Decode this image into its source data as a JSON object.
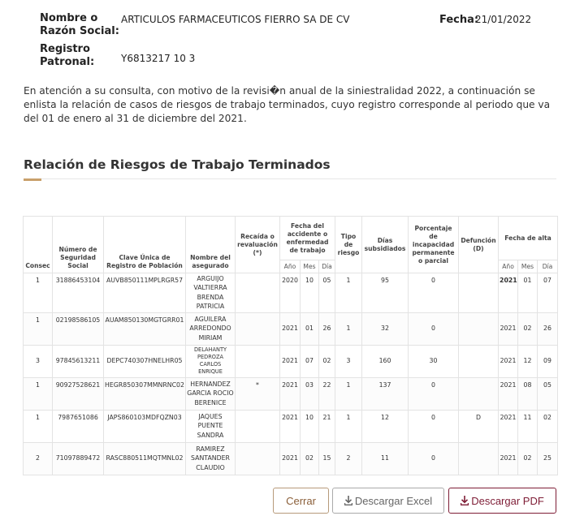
{
  "header": {
    "razon_label_1": "Nombre o",
    "razon_label_2": "Razón Social:",
    "razon_value": "ARTICULOS FARMACEUTICOS FIERRO SA DE CV",
    "fecha_label": "Fecha:",
    "fecha_value": "21/01/2022",
    "registro_label_1": "Registro",
    "registro_label_2": "Patronal:",
    "registro_value": "Y6813217 10 3"
  },
  "intro_text": "En atención a su consulta, con motivo de la revisi�n anual de la siniestralidad 2022, a continuación se enlista la relación de casos de riesgos de trabajo terminados, cuyo registro corresponde al periodo que va del 01 de enero al 31 de diciembre del 2021.",
  "section_title": "Relación de Riesgos de Trabajo Terminados",
  "table": {
    "headers": {
      "consec": "Consec",
      "nss": "Número de Seguridad Social",
      "curp": "Clave Única de Registro de Población",
      "nombre": "Nombre del asegurado",
      "recaida": "Recaída o revaluación (*)",
      "fecha_accidente": "Fecha del accidente o enfermedad de trabajo",
      "tipo": "Tipo de riesgo",
      "dias": "Días subsidiados",
      "porcentaje": "Porcentaje de incapacidad permanente o parcial",
      "defuncion": "Defunción (D)",
      "fecha_alta": "Fecha de alta",
      "anio": "Año",
      "mes": "Mes",
      "dia": "Día"
    },
    "rows": [
      {
        "consec": "1",
        "nss": "31886453104",
        "curp": "AUVB850111MPLRGR57",
        "nombre": "ARGUIJO VALTIERRA BRENDA PATRICIA",
        "recaida": "",
        "acc_anio": "2020",
        "acc_mes": "10",
        "acc_dia": "05",
        "tipo": "1",
        "dias": "95",
        "porcentaje": "0",
        "defuncion": "",
        "alta_anio": "2021",
        "alta_mes": "01",
        "alta_dia": "07"
      },
      {
        "consec": "1",
        "nss": "02198586105",
        "curp": "AUAM850130MGTGRR01",
        "nombre": "AGUILERA ARREDONDO MIRIAM",
        "recaida": "",
        "acc_anio": "2021",
        "acc_mes": "01",
        "acc_dia": "26",
        "tipo": "1",
        "dias": "32",
        "porcentaje": "0",
        "defuncion": "",
        "alta_anio": "2021",
        "alta_mes": "02",
        "alta_dia": "26"
      },
      {
        "consec": "3",
        "nss": "97845613211",
        "curp": "DEPC740307HNELHR05",
        "nombre": "DELAHANTY PEDROZA CARLOS ENRIQUE",
        "recaida": "",
        "acc_anio": "2021",
        "acc_mes": "07",
        "acc_dia": "02",
        "tipo": "3",
        "dias": "160",
        "porcentaje": "30",
        "defuncion": "",
        "alta_anio": "2021",
        "alta_mes": "12",
        "alta_dia": "09"
      },
      {
        "consec": "1",
        "nss": "90927528621",
        "curp": "HEGR850307MMNRNC02",
        "nombre": "HERNANDEZ GARCIA ROCIO BERENICE",
        "recaida": "*",
        "acc_anio": "2021",
        "acc_mes": "03",
        "acc_dia": "22",
        "tipo": "1",
        "dias": "137",
        "porcentaje": "0",
        "defuncion": "",
        "alta_anio": "2021",
        "alta_mes": "08",
        "alta_dia": "05"
      },
      {
        "consec": "1",
        "nss": "7987651086",
        "curp": "JAPS860103MDFQZN03",
        "nombre": "JAQUES PUENTE SANDRA",
        "recaida": "",
        "acc_anio": "2021",
        "acc_mes": "10",
        "acc_dia": "21",
        "tipo": "1",
        "dias": "12",
        "porcentaje": "0",
        "defuncion": "D",
        "alta_anio": "2021",
        "alta_mes": "11",
        "alta_dia": "02"
      },
      {
        "consec": "2",
        "nss": "71097889472",
        "curp": "RASC880511MQTMNL02",
        "nombre": "RAMIREZ SANTANDER CLAUDIO",
        "recaida": "",
        "acc_anio": "2021",
        "acc_mes": "02",
        "acc_dia": "15",
        "tipo": "2",
        "dias": "11",
        "porcentaje": "0",
        "defuncion": "",
        "alta_anio": "2021",
        "alta_mes": "02",
        "alta_dia": "25"
      }
    ]
  },
  "buttons": {
    "cerrar": "Cerrar",
    "excel": "Descargar Excel",
    "pdf": "Descargar PDF"
  },
  "icons": {
    "excel_icon": "download-icon",
    "pdf_icon": "download-icon"
  },
  "colors": {
    "accent": "#c9a06b",
    "pdf_brand": "#7e1d36",
    "cerrar_text": "#8a5e38"
  }
}
